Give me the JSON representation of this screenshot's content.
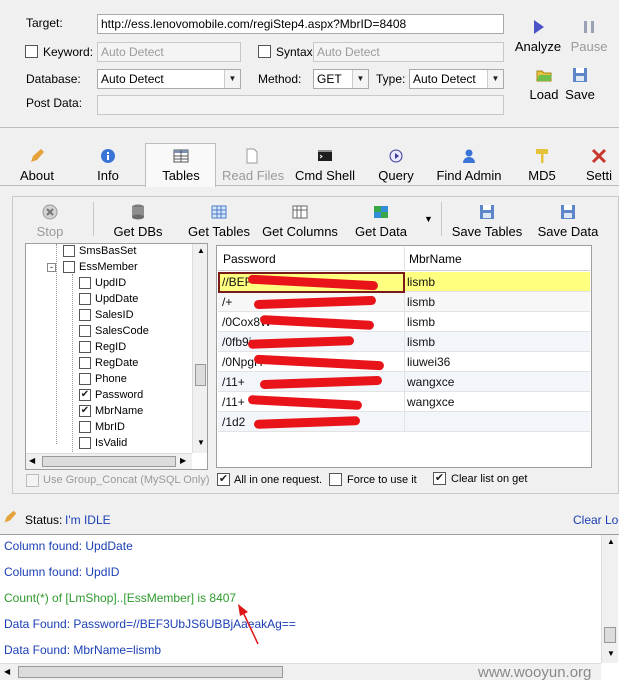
{
  "form": {
    "target_label": "Target:",
    "target_value": "http://ess.lenovomobile.com/regiStep4.aspx?MbrID=8408",
    "keyword_label": "Keyword:",
    "keyword_placeholder": "Auto Detect",
    "syntax_label": "Syntax:",
    "syntax_placeholder": "Auto Detect",
    "database_label": "Database:",
    "database_value": "Auto Detect",
    "method_label": "Method:",
    "method_value": "GET",
    "type_label": "Type:",
    "type_value": "Auto Detect",
    "postdata_label": "Post Data:"
  },
  "side_buttons": {
    "analyze": "Analyze",
    "pause": "Pause",
    "load": "Load",
    "save": "Save"
  },
  "tabs": [
    {
      "label": "About",
      "icon": "pen-icon"
    },
    {
      "label": "Info",
      "icon": "info-icon"
    },
    {
      "label": "Tables",
      "icon": "table-icon"
    },
    {
      "label": "Read Files",
      "icon": "file-icon"
    },
    {
      "label": "Cmd Shell",
      "icon": "console-icon"
    },
    {
      "label": "Query",
      "icon": "query-icon"
    },
    {
      "label": "Find Admin",
      "icon": "user-icon"
    },
    {
      "label": "MD5",
      "icon": "key-icon"
    },
    {
      "label": "Setti",
      "icon": "tools-icon"
    }
  ],
  "toolbar": {
    "stop": "Stop",
    "get_dbs": "Get DBs",
    "get_tables": "Get Tables",
    "get_columns": "Get Columns",
    "get_data": "Get Data",
    "save_tables": "Save Tables",
    "save_data": "Save Data"
  },
  "tree": {
    "items": [
      {
        "label": "SmsBasSet",
        "checked": false
      },
      {
        "label": "EssMember",
        "checked": false
      },
      {
        "label": "UpdID",
        "checked": false
      },
      {
        "label": "UpdDate",
        "checked": false
      },
      {
        "label": "SalesID",
        "checked": false
      },
      {
        "label": "SalesCode",
        "checked": false
      },
      {
        "label": "RegID",
        "checked": false
      },
      {
        "label": "RegDate",
        "checked": false
      },
      {
        "label": "Phone",
        "checked": false
      },
      {
        "label": "Password",
        "checked": true
      },
      {
        "label": "MbrName",
        "checked": true
      },
      {
        "label": "MbrID",
        "checked": false
      },
      {
        "label": "IsValid",
        "checked": false
      }
    ]
  },
  "grid": {
    "columns": [
      "Password",
      "MbrName"
    ],
    "rows": [
      {
        "password": "//BEF",
        "mbrname": "lismb"
      },
      {
        "password": "/+",
        "mbrname": "lismb"
      },
      {
        "password": "/0Cox8W",
        "mbrname": "lismb"
      },
      {
        "password": "/0fb9i",
        "mbrname": "lismb"
      },
      {
        "password": "/0NpgH",
        "mbrname": "liuwei36"
      },
      {
        "password": "/11+",
        "mbrname": "wangxce"
      },
      {
        "password": "/11+",
        "mbrname": "wangxce"
      },
      {
        "password": "/1d2",
        "mbrname": ""
      }
    ]
  },
  "options": {
    "group_concat": "Use Group_Concat (MySQL Only)",
    "all_in_one": "All in one request.",
    "force": "Force to use it",
    "clear_list": "Clear list on get"
  },
  "status": {
    "label": "Status:",
    "value": "I'm IDLE",
    "clear_log": "Clear Log"
  },
  "log": [
    {
      "text": "Column found: UpdDate",
      "color": "#1b3fb5"
    },
    {
      "text": "Column found: UpdID",
      "color": "#1b3fb5"
    },
    {
      "text": "Count(*) of [LmShop]..[EssMember] is 8407",
      "color": "#2e9a2e"
    },
    {
      "text": "Data Found: Password=//BEF3UbJS6UBBjAaeakAg==",
      "color": "#1b3fb5"
    },
    {
      "text": "Data Found: MbrName=lismb",
      "color": "#1b3fb5"
    }
  ],
  "watermark": "www.wooyun.org"
}
